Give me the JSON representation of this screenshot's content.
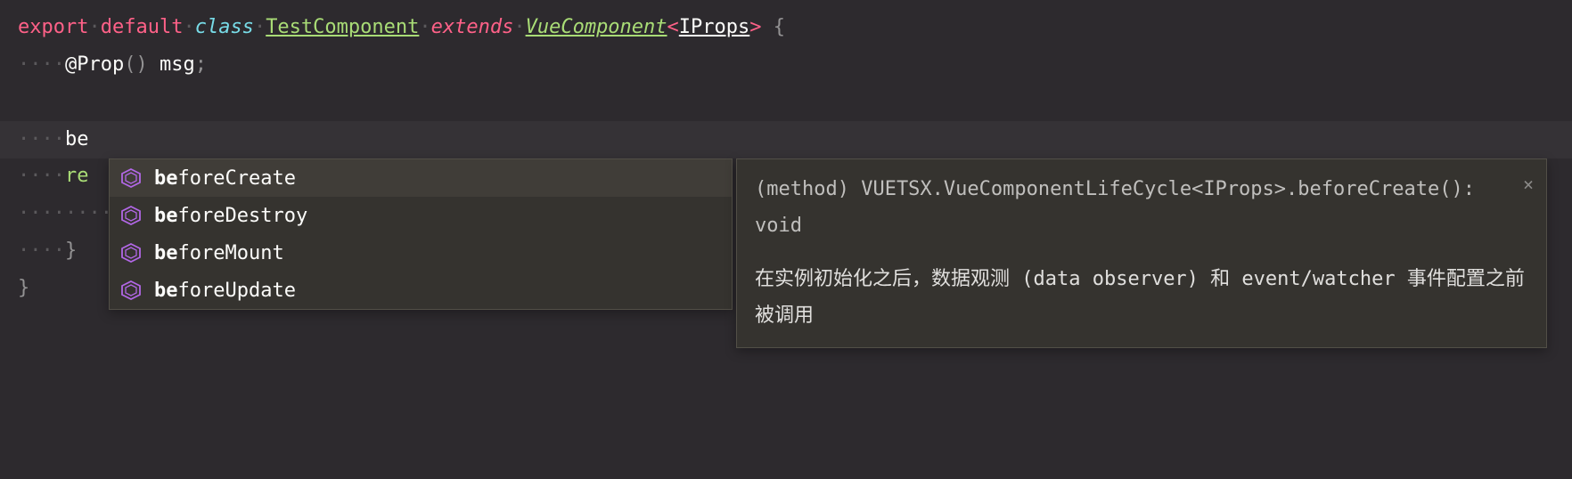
{
  "code": {
    "line1": {
      "export": "export",
      "default": "default",
      "class_kw": "class",
      "class_name": "TestComponent",
      "extends": "extends",
      "base_class": "VueComponent",
      "generic_open": "<",
      "generic_type": "IProps",
      "generic_close": ">",
      "brace": " {"
    },
    "line2": {
      "indent": "····",
      "decorator": "@Prop",
      "parens": "()",
      "space": " ",
      "prop": "msg",
      "semi": ";"
    },
    "line4": {
      "indent": "····",
      "text": "be"
    },
    "line5": {
      "indent": "····",
      "text": "re"
    },
    "line6": {
      "indent": "········"
    },
    "line7": {
      "indent": "····",
      "brace": "}"
    },
    "line8": {
      "brace": "}"
    }
  },
  "autocomplete": {
    "items": [
      {
        "match": "be",
        "rest": "foreCreate",
        "selected": true
      },
      {
        "match": "be",
        "rest": "foreDestroy",
        "selected": false
      },
      {
        "match": "be",
        "rest": "foreMount",
        "selected": false
      },
      {
        "match": "be",
        "rest": "foreUpdate",
        "selected": false
      }
    ]
  },
  "tooltip": {
    "signature": "(method) VUETSX.VueComponentLifeCycle<IProps>.beforeCreate(): void",
    "description": "在实例初始化之后，数据观测 (data observer) 和 event/watcher 事件配置之前被调用",
    "close": "×"
  }
}
